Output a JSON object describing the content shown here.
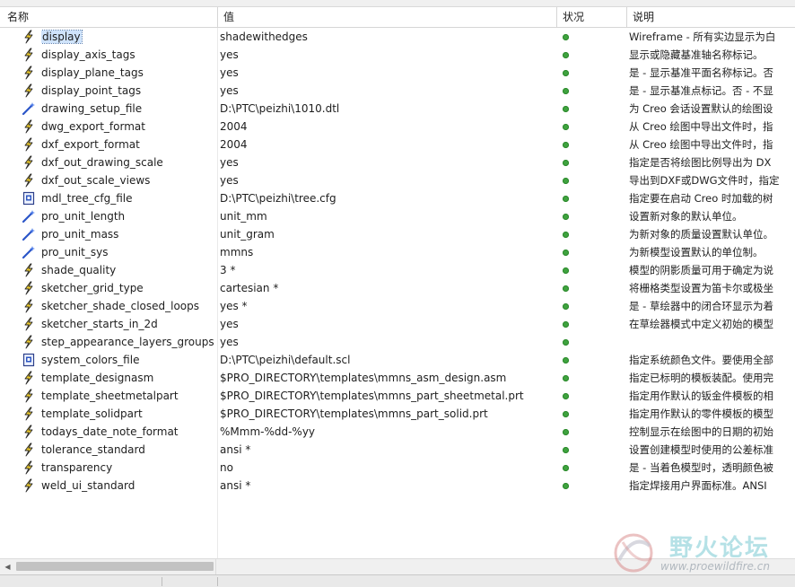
{
  "header": {
    "col_name": "名称",
    "col_value": "值",
    "col_status": "状况",
    "col_desc": "说明"
  },
  "status_color": "#3fa33f",
  "rows": [
    {
      "icon": "lightning-icon",
      "name": "display",
      "value": "shadewithedges",
      "desc": "Wireframe - 所有实边显示为白",
      "selected": true
    },
    {
      "icon": "lightning-icon",
      "name": "display_axis_tags",
      "value": "yes",
      "desc": "显示或隐藏基准轴名称标记。"
    },
    {
      "icon": "lightning-icon",
      "name": "display_plane_tags",
      "value": "yes",
      "desc": "是 - 显示基准平面名称标记。否"
    },
    {
      "icon": "lightning-icon",
      "name": "display_point_tags",
      "value": "yes",
      "desc": "是 - 显示基准点标记。否 - 不显"
    },
    {
      "icon": "wand-icon",
      "name": "drawing_setup_file",
      "value": "D:\\PTC\\peizhi\\1010.dtl",
      "desc": "为 Creo 会话设置默认的绘图设"
    },
    {
      "icon": "lightning-icon",
      "name": "dwg_export_format",
      "value": "2004",
      "desc": "从 Creo 绘图中导出文件时，指"
    },
    {
      "icon": "lightning-icon",
      "name": "dxf_export_format",
      "value": "2004",
      "desc": "从 Creo 绘图中导出文件时，指"
    },
    {
      "icon": "lightning-icon",
      "name": "dxf_out_drawing_scale",
      "value": "yes",
      "desc": "指定是否将绘图比例导出为 DX"
    },
    {
      "icon": "lightning-icon",
      "name": "dxf_out_scale_views",
      "value": "yes",
      "desc": "导出到DXF或DWG文件时，指定"
    },
    {
      "icon": "file-icon",
      "name": "mdl_tree_cfg_file",
      "value": "D:\\PTC\\peizhi\\tree.cfg",
      "desc": "指定要在启动 Creo 时加载的树"
    },
    {
      "icon": "wand-icon",
      "name": "pro_unit_length",
      "value": "unit_mm",
      "desc": "设置新对象的默认单位。"
    },
    {
      "icon": "wand-icon",
      "name": "pro_unit_mass",
      "value": "unit_gram",
      "desc": "为新对象的质量设置默认单位。"
    },
    {
      "icon": "wand-icon",
      "name": "pro_unit_sys",
      "value": "mmns",
      "desc": "为新模型设置默认的单位制。"
    },
    {
      "icon": "lightning-icon",
      "name": "shade_quality",
      "value": "3 *",
      "desc": "模型的阴影质量可用于确定为说"
    },
    {
      "icon": "lightning-icon",
      "name": "sketcher_grid_type",
      "value": "cartesian *",
      "desc": "将栅格类型设置为笛卡尔或极坐"
    },
    {
      "icon": "lightning-icon",
      "name": "sketcher_shade_closed_loops",
      "value": "yes *",
      "desc": "是 - 草绘器中的闭合环显示为着"
    },
    {
      "icon": "lightning-icon",
      "name": "sketcher_starts_in_2d",
      "value": "yes",
      "desc": "在草绘器模式中定义初始的模型"
    },
    {
      "icon": "lightning-icon",
      "name": "step_appearance_layers_groups",
      "value": "yes",
      "desc": ""
    },
    {
      "icon": "file-icon",
      "name": "system_colors_file",
      "value": "D:\\PTC\\peizhi\\default.scl",
      "desc": "指定系统颜色文件。要使用全部"
    },
    {
      "icon": "lightning-icon",
      "name": "template_designasm",
      "value": "$PRO_DIRECTORY\\templates\\mmns_asm_design.asm",
      "desc": "指定已标明的模板装配。使用完"
    },
    {
      "icon": "lightning-icon",
      "name": "template_sheetmetalpart",
      "value": "$PRO_DIRECTORY\\templates\\mmns_part_sheetmetal.prt",
      "desc": "指定用作默认的钣金件模板的相"
    },
    {
      "icon": "lightning-icon",
      "name": "template_solidpart",
      "value": "$PRO_DIRECTORY\\templates\\mmns_part_solid.prt",
      "desc": "指定用作默认的零件模板的模型"
    },
    {
      "icon": "lightning-icon",
      "name": "todays_date_note_format",
      "value": "%Mmm-%dd-%yy",
      "desc": "控制显示在绘图中的日期的初始"
    },
    {
      "icon": "lightning-icon",
      "name": "tolerance_standard",
      "value": "ansi *",
      "desc": "设置创建模型时使用的公差标准"
    },
    {
      "icon": "lightning-icon",
      "name": "transparency",
      "value": "no",
      "desc": "是 - 当着色模型时，透明颜色被"
    },
    {
      "icon": "lightning-icon",
      "name": "weld_ui_standard",
      "value": "ansi *",
      "desc": "指定焊接用户界面标准。ANSI"
    }
  ],
  "watermark": {
    "title": "野火论坛",
    "url": "www.proewildfire.cn"
  }
}
